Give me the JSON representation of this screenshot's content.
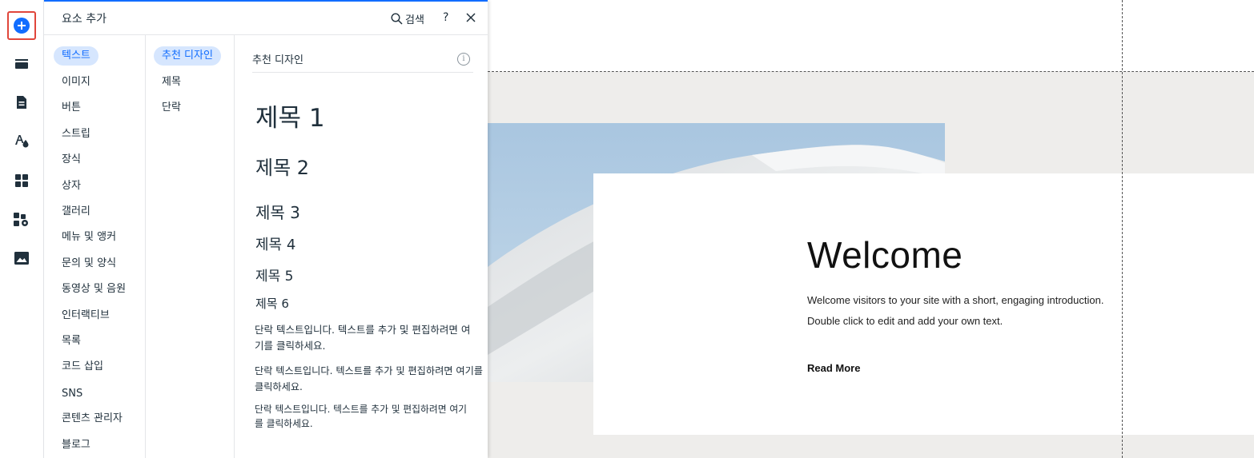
{
  "rail": {
    "icons": [
      "add-element-icon",
      "sections-icon",
      "pages-icon",
      "theme-icon",
      "apps-icon",
      "business-icon",
      "media-icon"
    ]
  },
  "panel": {
    "title": "요소 추가",
    "search_label": "검색",
    "help_label": "?",
    "categories": [
      "텍스트",
      "이미지",
      "버튼",
      "스트립",
      "장식",
      "상자",
      "갤러리",
      "메뉴 및 앵커",
      "문의 및 양식",
      "동영상 및 음원",
      "인터랙티브",
      "목록",
      "코드 삽입",
      "SNS",
      "콘텐츠 관리자",
      "블로그"
    ],
    "subcategories": [
      "추천 디자인",
      "제목",
      "단락"
    ],
    "section_title": "추천 디자인",
    "info_label": "i",
    "headings": [
      "제목 1",
      "제목 2",
      "제목 3",
      "제목 4",
      "제목 5",
      "제목 6"
    ],
    "paragraphs": [
      "단락 텍스트입니다. 텍스트를 추가 및 편집하려면 여기를 클릭하세요.",
      "단락 텍스트입니다. 텍스트를 추가 및 편집하려면 여기를 클릭하세요.",
      "단락 텍스트입니다. 텍스트를 추가 및 편집하려면 여기를 클릭하세요."
    ]
  },
  "canvas": {
    "welcome_title": "Welcome",
    "intro_text": "Welcome visitors to your site with a short, engaging introduction. Double click to edit and add your own text.",
    "read_more": "Read More"
  },
  "colors": {
    "accent": "#116dff",
    "highlight_border": "#e0463b",
    "active_bg": "#d6e6fe",
    "canvas_gray": "#eeedeb"
  }
}
